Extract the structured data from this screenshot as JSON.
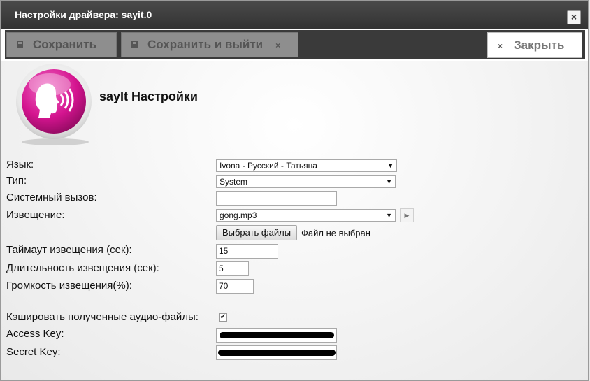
{
  "window": {
    "title": "Настройки драйвера: sayit.0",
    "close_symbol": "×"
  },
  "toolbar": {
    "save_label": "Сохранить",
    "save_exit_label": "Сохранить и выйти",
    "close_label": "Закрыть",
    "close_symbol": "×"
  },
  "header": {
    "title": "sayIt Настройки"
  },
  "form": {
    "language": {
      "label": "Язык:",
      "value": "Ivona - Русский - Татьяна"
    },
    "type": {
      "label": "Тип:",
      "value": "System"
    },
    "system_call": {
      "label": "Системный вызов:",
      "value": ""
    },
    "notification": {
      "label": "Извещение:",
      "value": "gong.mp3",
      "play_symbol": "▶"
    },
    "file": {
      "button_label": "Выбрать файлы",
      "status": "Файл не выбран"
    },
    "timeout": {
      "label": "Таймаут извещения (сек):",
      "value": "15"
    },
    "duration": {
      "label": "Длительность извещения (сек):",
      "value": "5"
    },
    "volume": {
      "label": "Громкость извещения(%):",
      "value": "70"
    },
    "cache": {
      "label": "Кэшировать полученные аудио-файлы:",
      "checked": true,
      "check_symbol": "✔"
    },
    "access_key": {
      "label": "Access Key:"
    },
    "secret_key": {
      "label": "Secret Key:"
    }
  },
  "colors": {
    "logo_magenta": "#d4148f",
    "titlebar": "#3a3a3a"
  }
}
